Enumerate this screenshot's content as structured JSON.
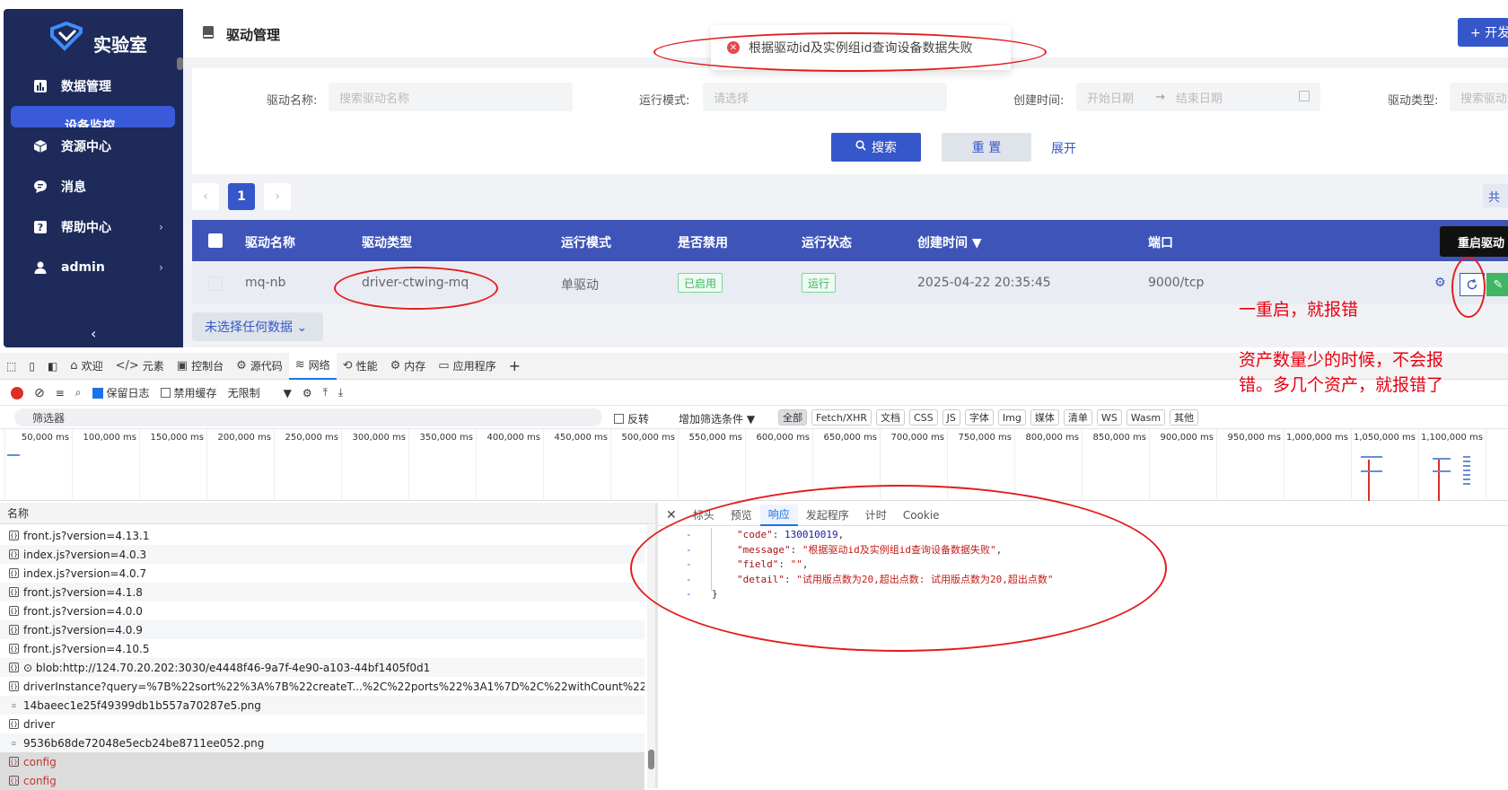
{
  "sidebar": {
    "brand": "实验室",
    "items": [
      {
        "label": "数据管理",
        "icon": "chart-icon"
      },
      {
        "label": "设备监控",
        "icon": "monitor-icon"
      },
      {
        "label": "资源中心",
        "icon": "cube-icon"
      },
      {
        "label": "消息",
        "icon": "message-icon"
      },
      {
        "label": "帮助中心",
        "icon": "help-icon"
      },
      {
        "label": "admin",
        "icon": "user-icon"
      }
    ],
    "collapse_icon": "‹"
  },
  "header": {
    "title": "驱动管理",
    "add_button": "+ 开发"
  },
  "toast": {
    "message": "根据驱动id及实例组id查询设备数据失败"
  },
  "filters": {
    "driver_name_label": "驱动名称:",
    "driver_name_placeholder": "搜索驱动名称",
    "run_mode_label": "运行模式:",
    "run_mode_placeholder": "请选择",
    "created_label": "创建时间:",
    "start_date": "开始日期",
    "date_arrow": "→",
    "end_date": "结束日期",
    "driver_type_label": "驱动类型:",
    "driver_type_placeholder": "搜索驱动",
    "search": "搜索",
    "reset": "重 置",
    "expand": "展开"
  },
  "pager": {
    "prev": "‹",
    "current": "1",
    "next": "›",
    "total": "共"
  },
  "table": {
    "columns": [
      "驱动名称",
      "驱动类型",
      "运行模式",
      "是否禁用",
      "运行状态",
      "创建时间 ▼",
      "端口"
    ],
    "row": {
      "name": "mq-nb",
      "type": "driver-ctwing-mq",
      "mode": "单驱动",
      "enabled": "已启用",
      "status": "运行",
      "created": "2025-04-22 20:35:45",
      "port": "9000/tcp"
    },
    "tooltip": "重启驱动",
    "none_selected": "未选择任何数据 ⌄"
  },
  "annotations": {
    "note1": "一重启，就报错",
    "note2_line1": "资产数量少的时候，不会报",
    "note2_line2": "错。多几个资产，就报错了"
  },
  "devtools": {
    "tabs": [
      {
        "label": "欢迎",
        "icon": "⌂"
      },
      {
        "label": "元素",
        "icon": "</>"
      },
      {
        "label": "控制台",
        "icon": "▣"
      },
      {
        "label": "源代码",
        "icon": "⚙"
      },
      {
        "label": "网络",
        "icon": "📶"
      },
      {
        "label": "性能",
        "icon": "⟲"
      },
      {
        "label": "内存",
        "icon": "⚙"
      },
      {
        "label": "应用程序",
        "icon": "▭"
      }
    ],
    "toolbar": {
      "preserve_log": "保留日志",
      "disable_cache": "禁用缓存",
      "throttle": "无限制"
    },
    "filter": {
      "placeholder": "筛选器",
      "invert": "反转",
      "more_filters": "增加筛选条件 ▼",
      "types": [
        "全部",
        "Fetch/XHR",
        "文档",
        "CSS",
        "JS",
        "字体",
        "Img",
        "媒体",
        "清单",
        "WS",
        "Wasm",
        "其他"
      ]
    },
    "timeline_ticks": [
      "50,000 ms",
      "100,000 ms",
      "150,000 ms",
      "200,000 ms",
      "250,000 ms",
      "300,000 ms",
      "350,000 ms",
      "400,000 ms",
      "450,000 ms",
      "500,000 ms",
      "550,000 ms",
      "600,000 ms",
      "650,000 ms",
      "700,000 ms",
      "750,000 ms",
      "800,000 ms",
      "850,000 ms",
      "900,000 ms",
      "950,000 ms",
      "1,000,000 ms",
      "1,050,000 ms",
      "1,100,000 ms",
      "1,1"
    ],
    "names_header": "名称",
    "requests": [
      "front.js?version=4.13.1",
      "index.js?version=4.0.3",
      "index.js?version=4.0.7",
      "front.js?version=4.1.8",
      "front.js?version=4.0.0",
      "front.js?version=4.0.9",
      "front.js?version=4.10.5",
      "⊙ blob:http://124.70.20.202:3030/e4448f46-9a7f-4e90-a103-44bf1405f0d1",
      "driverInstance?query=%7B%22sort%22%3A%7B%22createT...%2C%22ports%22%3A1%7D%2C%22withCount%22%3...",
      "14baeec1e25f49399db1b557a70287e5.png",
      "driver",
      "9536b68de72048e5ecb24be8711ee052.png",
      "config",
      "config"
    ],
    "detail_tabs": [
      "标头",
      "预览",
      "响应",
      "发起程序",
      "计时",
      "Cookie"
    ],
    "response": {
      "code_key": "\"code\"",
      "code_val": "130010019",
      "message_key": "\"message\"",
      "message_val": "\"根据驱动id及实例组id查询设备数据失败\"",
      "field_key": "\"field\"",
      "field_val": "\"\"",
      "detail_key": "\"detail\"",
      "detail_val": "\"试用版点数为20,超出点数: 试用版点数为20,超出点数\"",
      "close": "}"
    }
  },
  "colors": {
    "sidebar": "#1d2a5a",
    "accent": "#3657c9",
    "table_header": "#3e54b8",
    "annotation_red": "#e60012"
  }
}
